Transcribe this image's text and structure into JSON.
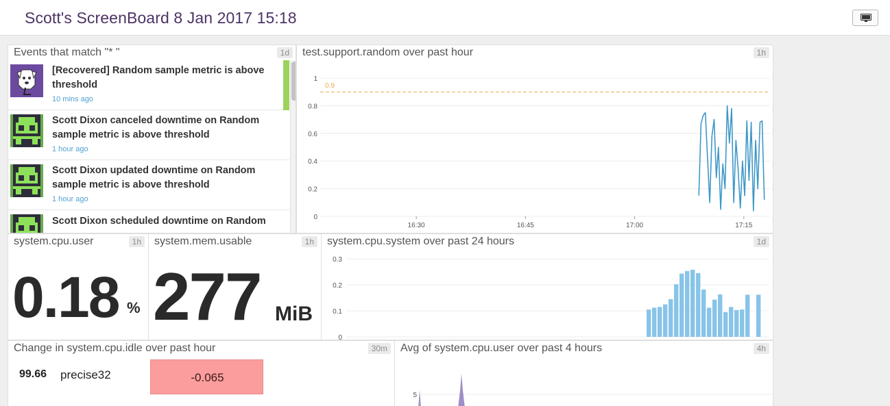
{
  "board": {
    "title": "Scott's ScreenBoard 8 Jan 2017 15:18"
  },
  "events_widget": {
    "title": "Events that match \"* \"",
    "badge": "1d",
    "items": [
      {
        "text": "[Recovered] Random sample metric is above threshold",
        "time": "10 mins ago",
        "avatar": "datadog-dog-icon"
      },
      {
        "text": "Scott Dixon canceled downtime on Random sample metric is above threshold",
        "time": "1 hour ago",
        "avatar": "pixel-invader-icon"
      },
      {
        "text": "Scott Dixon updated downtime on Random sample metric is above threshold",
        "time": "1 hour ago",
        "avatar": "pixel-invader-icon"
      },
      {
        "text": "Scott Dixon scheduled downtime on Random",
        "time": "",
        "avatar": "pixel-invader-icon"
      }
    ]
  },
  "support_random": {
    "title": "test.support.random over past hour",
    "badge": "1h",
    "chart_data": {
      "type": "line",
      "title": "test.support.random over past hour",
      "x_ticks": [
        "16:30",
        "16:45",
        "17:00",
        "17:15"
      ],
      "y_ticks": [
        "0",
        "0.2",
        "0.4",
        "0.6",
        "0.8",
        "1"
      ],
      "ylim": [
        0,
        1
      ],
      "threshold": {
        "label": "0.9",
        "value": 0.9,
        "color": "#f0a64b"
      },
      "color": "#3f97c7",
      "series": [
        {
          "points": [
            [
              17.147,
              0.15
            ],
            [
              17.152,
              0.67
            ],
            [
              17.157,
              0.73
            ],
            [
              17.162,
              0.75
            ],
            [
              17.167,
              0.42
            ],
            [
              17.172,
              0.1
            ],
            [
              17.177,
              0.58
            ],
            [
              17.182,
              0.7
            ],
            [
              17.187,
              0.28
            ],
            [
              17.192,
              0.5
            ],
            [
              17.197,
              0.05
            ],
            [
              17.202,
              0.38
            ],
            [
              17.207,
              0.2
            ],
            [
              17.212,
              0.8
            ],
            [
              17.217,
              0.53
            ],
            [
              17.222,
              0.78
            ],
            [
              17.227,
              0.1
            ],
            [
              17.232,
              0.55
            ],
            [
              17.237,
              0.34
            ],
            [
              17.242,
              0.06
            ],
            [
              17.247,
              0.4
            ],
            [
              17.252,
              0.15
            ],
            [
              17.257,
              0.69
            ],
            [
              17.262,
              0.26
            ],
            [
              17.267,
              0.68
            ],
            [
              17.272,
              0.04
            ],
            [
              17.277,
              0.55
            ],
            [
              17.282,
              0.2
            ],
            [
              17.287,
              0.68
            ],
            [
              17.292,
              0.69
            ],
            [
              17.297,
              0.12
            ]
          ]
        }
      ]
    }
  },
  "cpu_user": {
    "title": "system.cpu.user",
    "badge": "1h",
    "value": "0.18",
    "unit": "%"
  },
  "mem_usable": {
    "title": "system.mem.usable",
    "badge": "1h",
    "value": "277",
    "unit": "MiB"
  },
  "cpu_system": {
    "title": "system.cpu.system over past 24 hours",
    "badge": "1d",
    "chart_data": {
      "type": "bar",
      "title": "system.cpu.system over past 24 hours",
      "y_ticks": [
        "0",
        "0.1",
        "0.2",
        "0.3"
      ],
      "ylim": [
        0,
        0.3
      ],
      "color": "#88c4e8",
      "values": [
        0.105,
        0.112,
        0.115,
        0.125,
        0.145,
        0.202,
        0.243,
        0.253,
        0.258,
        0.245,
        0.182,
        0.112,
        0.143,
        0.163,
        0.095,
        0.115,
        0.103,
        0.105,
        0.162,
        0,
        0.162
      ],
      "offset_slots": 0
    }
  },
  "cpu_idle_change": {
    "title": "Change in system.cpu.idle over past hour",
    "badge": "30m",
    "value": "99.66",
    "host": "precise32",
    "change": "-0.065"
  },
  "cpu_user_avg": {
    "title": "Avg of system.cpu.user over past 4 hours",
    "badge": "4h",
    "chart_data": {
      "type": "area",
      "title": "Avg of system.cpu.user over past 4 hours",
      "y_ticks": [
        "5"
      ],
      "color": "#8d7bbd"
    }
  }
}
